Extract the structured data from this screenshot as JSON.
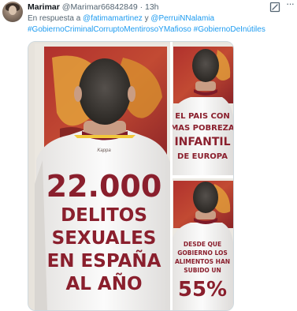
{
  "tweet": {
    "author_name": "Marimar",
    "handle": "@Marimar66842849",
    "separator": "·",
    "time": "13h",
    "reply_prefix": "En respuesta a",
    "reply_to": [
      "@fatimamartinez",
      "@PerruiNNalamia"
    ],
    "reply_joiner": "y",
    "hashtags": [
      "#GobiernoCriminalCorruptoMentirosoYMafioso",
      "#GobiernoDeInútiles"
    ]
  },
  "icons": {
    "avatar": "avatar-photo",
    "grok": "grok-icon",
    "more": "more-options-icon"
  },
  "media": {
    "panel_main": {
      "brand": "Kappa",
      "lines": [
        "22.000",
        "DELITOS",
        "SEXUALES",
        "EN ESPAÑA",
        "AL AÑO"
      ]
    },
    "panel_top_right": {
      "lines": [
        "EL PAIS CON",
        "MAS POBREZA",
        "INFANTIL",
        "DE EUROPA"
      ]
    },
    "panel_bottom_right": {
      "lines": [
        "DESDE QUE",
        "GOBIERNO LOS",
        "ALIMENTOS HAN",
        "SUBIDO UN",
        "55%"
      ]
    }
  },
  "colors": {
    "link": "#1d9bf0",
    "muted": "#536471",
    "shirt_text": "#8a1f2d"
  }
}
